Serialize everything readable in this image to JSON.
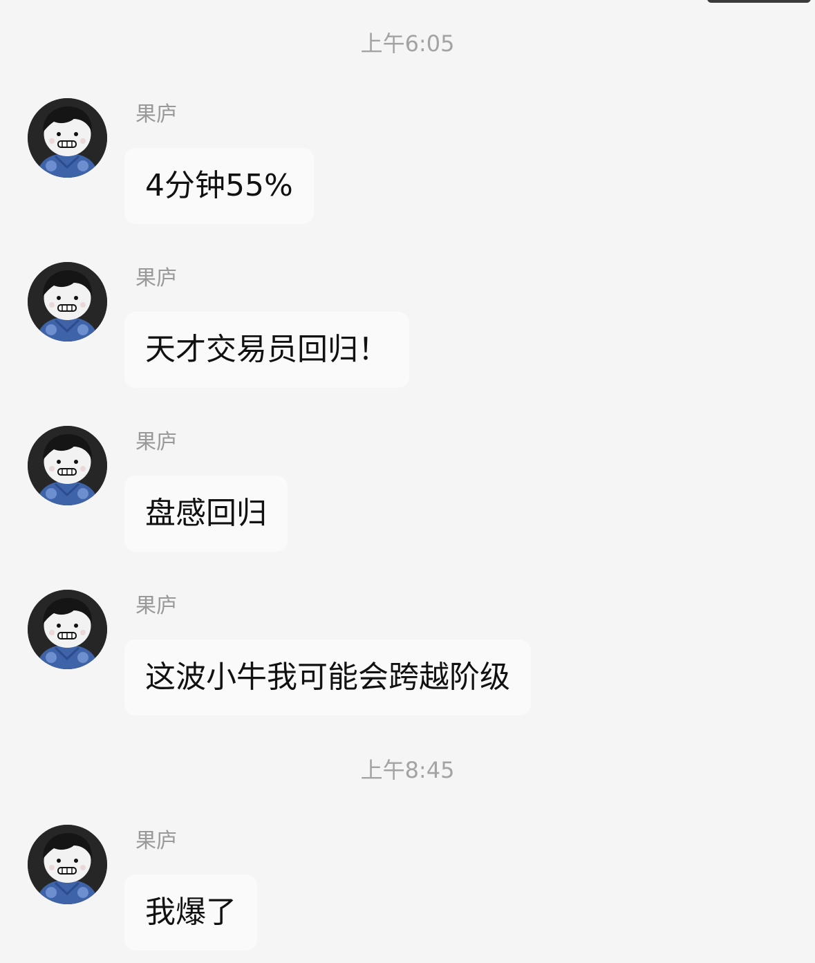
{
  "timestamps": [
    "上午6:05",
    "上午8:45"
  ],
  "messages": [
    {
      "sender": "果庐",
      "text": "4分钟55%",
      "avatar": "cartoon-boy-avatar"
    },
    {
      "sender": "果庐",
      "text": "天才交易员回归！",
      "avatar": "cartoon-boy-avatar"
    },
    {
      "sender": "果庐",
      "text": "盘感回归",
      "avatar": "cartoon-boy-avatar"
    },
    {
      "sender": "果庐",
      "text": "这波小牛我可能会跨越阶级",
      "avatar": "cartoon-boy-avatar"
    },
    {
      "sender": "果庐",
      "text": "我爆了",
      "avatar": "cartoon-boy-avatar"
    }
  ]
}
